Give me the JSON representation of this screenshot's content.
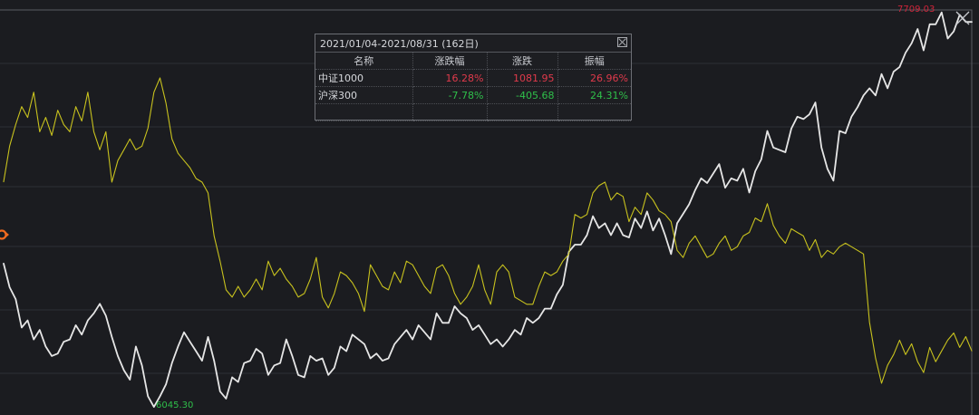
{
  "range_title": "2021/01/04-2021/08/31 (162日)",
  "table": {
    "headers": [
      "名称",
      "涨跌幅",
      "涨跌",
      "振幅"
    ],
    "rows": [
      {
        "name": "中证1000",
        "pct": "16.28%",
        "chg": "1081.95",
        "amp": "26.96%",
        "pct_color": "#e03a4b",
        "chg_color": "#e03a4b",
        "amp_color": "#e03a4b"
      },
      {
        "name": "沪深300",
        "pct": "-7.78%",
        "chg": "-405.68",
        "amp": "24.31%",
        "pct_color": "#2fbf4a",
        "chg_color": "#2fbf4a",
        "amp_color": "#2fbf4a"
      }
    ]
  },
  "max_label": "7709.03",
  "min_label": "6045.30",
  "colors": {
    "background": "#1b1c20",
    "white_series": "#e6e6e6",
    "yellow_series": "#c8c21e",
    "up": "#e03a4b",
    "down": "#2fbf4a",
    "marker": "#f06a1f"
  },
  "chart_data": {
    "type": "line",
    "x": "trading days 2021/01/04 - 2021/08/31",
    "series": [
      {
        "name": "中证1000",
        "color": "#e6e6e6",
        "values": [
          6650,
          6550,
          6500,
          6380,
          6410,
          6330,
          6370,
          6300,
          6260,
          6270,
          6320,
          6330,
          6390,
          6350,
          6410,
          6440,
          6480,
          6430,
          6340,
          6260,
          6200,
          6160,
          6300,
          6220,
          6090,
          6045,
          6090,
          6140,
          6230,
          6300,
          6360,
          6320,
          6280,
          6240,
          6340,
          6240,
          6110,
          6080,
          6170,
          6150,
          6230,
          6240,
          6290,
          6270,
          6180,
          6220,
          6230,
          6330,
          6260,
          6180,
          6170,
          6260,
          6240,
          6250,
          6180,
          6210,
          6300,
          6280,
          6350,
          6330,
          6310,
          6250,
          6270,
          6240,
          6250,
          6310,
          6340,
          6370,
          6330,
          6390,
          6360,
          6330,
          6440,
          6400,
          6400,
          6470,
          6440,
          6420,
          6370,
          6390,
          6350,
          6310,
          6330,
          6300,
          6330,
          6370,
          6350,
          6420,
          6400,
          6420,
          6460,
          6460,
          6520,
          6560,
          6700,
          6730,
          6730,
          6770,
          6850,
          6800,
          6820,
          6770,
          6820,
          6770,
          6760,
          6840,
          6800,
          6870,
          6790,
          6840,
          6770,
          6690,
          6820,
          6860,
          6900,
          6960,
          7010,
          6990,
          7030,
          7070,
          6970,
          7010,
          7000,
          7050,
          6950,
          7040,
          7090,
          7210,
          7140,
          7130,
          7120,
          7220,
          7270,
          7260,
          7280,
          7330,
          7140,
          7050,
          7000,
          7210,
          7200,
          7270,
          7310,
          7360,
          7390,
          7360,
          7450,
          7390,
          7460,
          7480,
          7540,
          7580,
          7640,
          7550,
          7660,
          7660,
          7710,
          7600,
          7630,
          7700,
          7670,
          7670
        ]
      },
      {
        "name": "沪深300",
        "color": "#c8c21e",
        "values": [
          5211,
          5310,
          5370,
          5420,
          5390,
          5460,
          5350,
          5390,
          5340,
          5410,
          5370,
          5350,
          5420,
          5380,
          5460,
          5350,
          5300,
          5350,
          5210,
          5270,
          5300,
          5330,
          5300,
          5310,
          5360,
          5460,
          5500,
          5430,
          5330,
          5290,
          5270,
          5250,
          5220,
          5210,
          5180,
          5060,
          4990,
          4910,
          4890,
          4920,
          4890,
          4910,
          4940,
          4910,
          4990,
          4950,
          4970,
          4940,
          4920,
          4890,
          4900,
          4940,
          5000,
          4890,
          4860,
          4900,
          4960,
          4950,
          4930,
          4900,
          4850,
          4980,
          4950,
          4920,
          4910,
          4960,
          4930,
          4990,
          4980,
          4950,
          4920,
          4900,
          4970,
          4980,
          4950,
          4900,
          4870,
          4890,
          4920,
          4980,
          4910,
          4870,
          4960,
          4980,
          4960,
          4890,
          4880,
          4870,
          4870,
          4920,
          4960,
          4950,
          4960,
          4990,
          5010,
          5120,
          5110,
          5120,
          5180,
          5200,
          5210,
          5160,
          5180,
          5170,
          5100,
          5140,
          5120,
          5180,
          5160,
          5130,
          5120,
          5100,
          5020,
          5000,
          5040,
          5060,
          5030,
          5000,
          5010,
          5040,
          5060,
          5020,
          5030,
          5060,
          5070,
          5110,
          5100,
          5150,
          5090,
          5060,
          5040,
          5080,
          5070,
          5060,
          5020,
          5050,
          5000,
          5020,
          5010,
          5030,
          5040,
          5030,
          5020,
          5010,
          4820,
          4720,
          4650,
          4700,
          4730,
          4770,
          4730,
          4760,
          4710,
          4680,
          4750,
          4710,
          4740,
          4770,
          4790,
          4750,
          4780,
          4740
        ]
      }
    ],
    "max_value": 7709.03,
    "min_value": 6045.3
  }
}
